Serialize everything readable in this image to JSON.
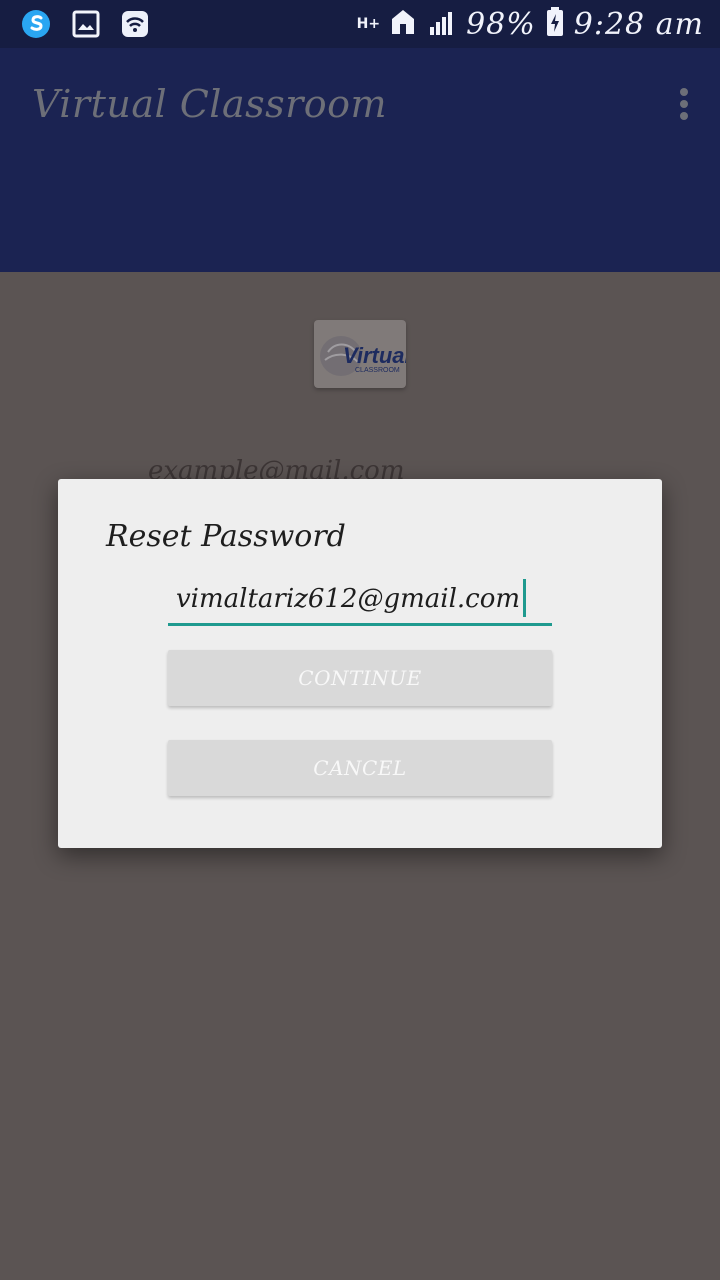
{
  "status_bar": {
    "network": "H+",
    "battery": "98%",
    "time": "9:28 am"
  },
  "app_bar": {
    "title": "Virtual Classroom"
  },
  "logo": {
    "primary_text": "Virtual",
    "secondary_text": "CLASSROOM"
  },
  "background": {
    "email_placeholder": "example@mail.com"
  },
  "dialog": {
    "title": "Reset Password",
    "email_value": "vimaltariz612@gmail.com",
    "continue_label": "CONTINUE",
    "cancel_label": "CANCEL"
  },
  "colors": {
    "primary": "#1b2352",
    "status_bar": "#161d42",
    "accent": "#1f9a8f",
    "dialog": "#eeeeee",
    "dim": "#5b5453"
  },
  "icons": {
    "status_left": [
      "sync-app-icon",
      "image-notification-icon",
      "wifi-icon"
    ],
    "status_right": [
      "network-type-icon",
      "home-signal-icon",
      "signal-strength-icon",
      "battery-icon"
    ],
    "app_bar": "overflow-menu-icon"
  }
}
